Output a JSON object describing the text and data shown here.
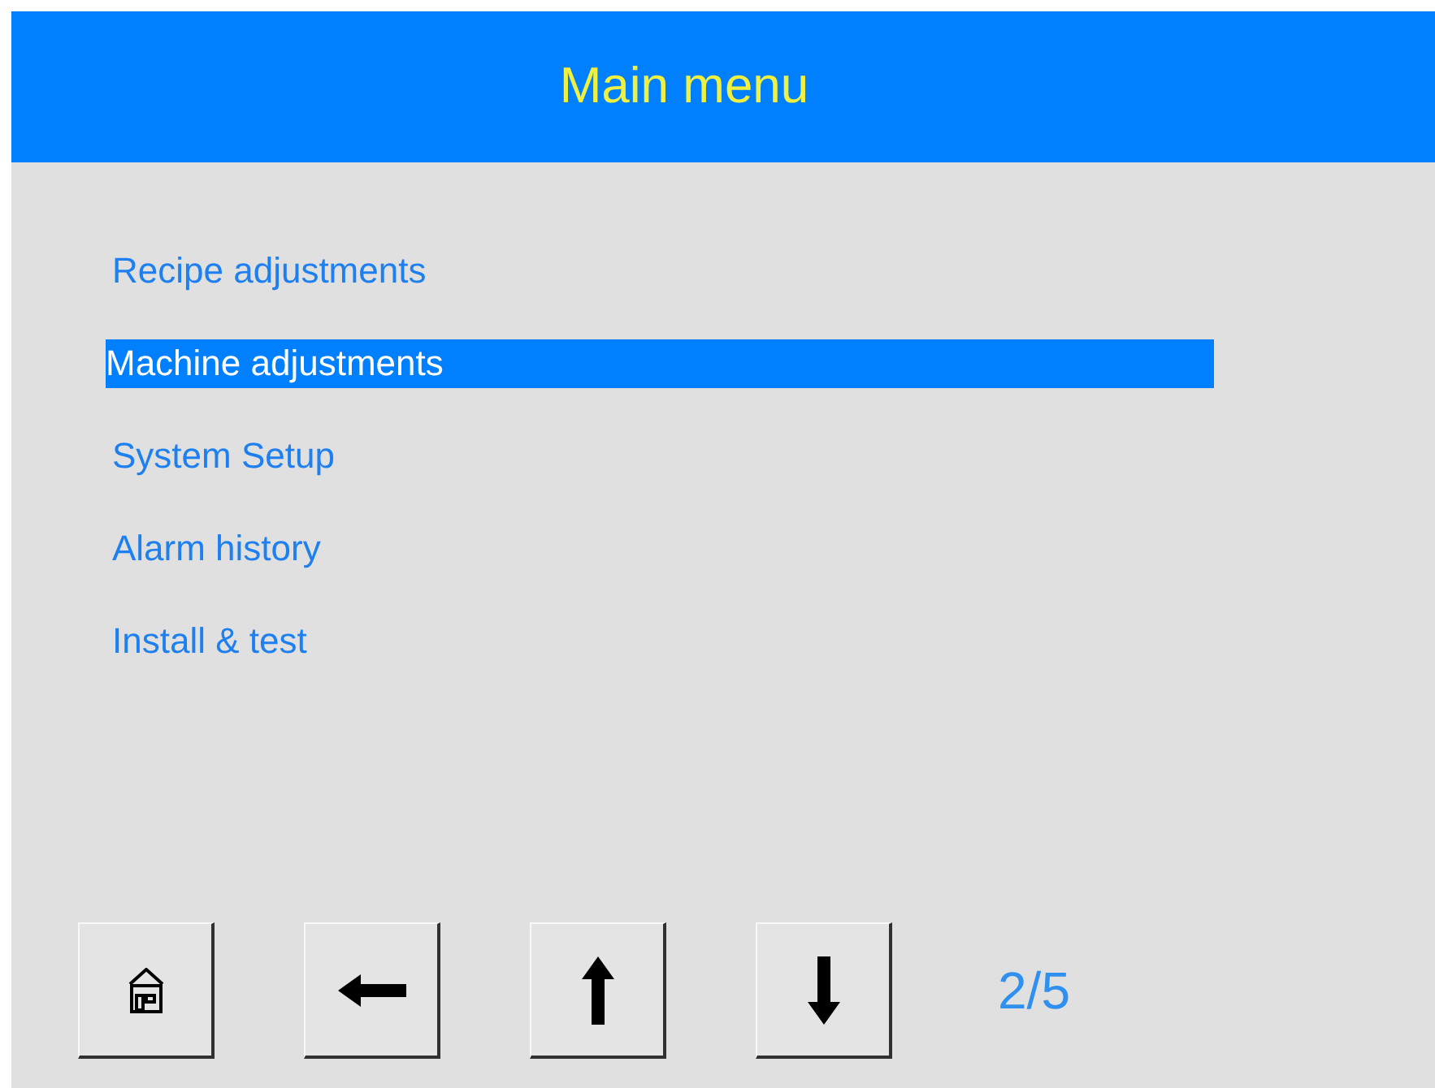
{
  "header": {
    "title": "Main menu"
  },
  "menu": [
    {
      "label": "Recipe adjustments",
      "selected": false
    },
    {
      "label": "Machine adjustments",
      "selected": true
    },
    {
      "label": "System Setup",
      "selected": false
    },
    {
      "label": "Alarm history",
      "selected": false
    },
    {
      "label": "Install & test",
      "selected": false
    }
  ],
  "toolbar": [
    {
      "kind": "home"
    },
    {
      "kind": "left"
    },
    {
      "kind": "up"
    },
    {
      "kind": "down"
    }
  ],
  "page_indicator": "2/5"
}
